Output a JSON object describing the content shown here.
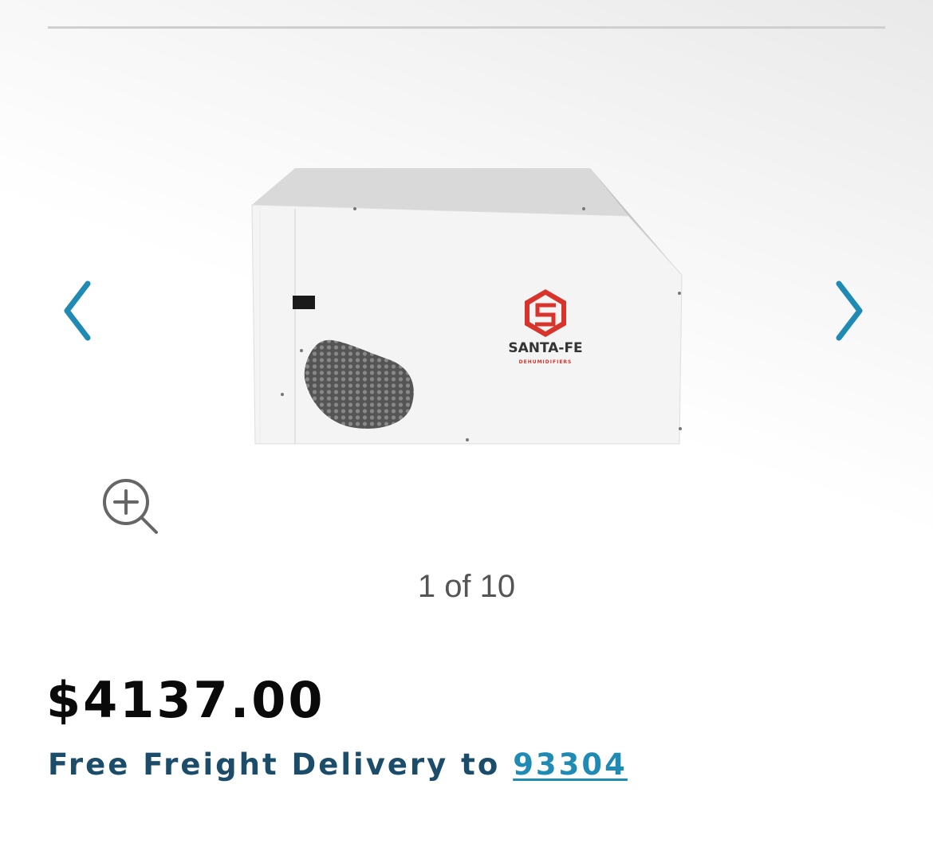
{
  "gallery": {
    "prev_icon": "chevron-left-icon",
    "next_icon": "chevron-right-icon",
    "zoom_icon": "zoom-in-icon",
    "counter": "1 of 10",
    "accent_color": "#1f8bb5",
    "product_image": {
      "brand_logo_text": "SANTA-FE",
      "brand_logo_subtext": "DEHUMIDIFIERS",
      "logo_color": "#d8342b"
    }
  },
  "product": {
    "price": "$4137.00",
    "delivery_prefix": "Free Freight Delivery to",
    "delivery_zip": "93304"
  }
}
